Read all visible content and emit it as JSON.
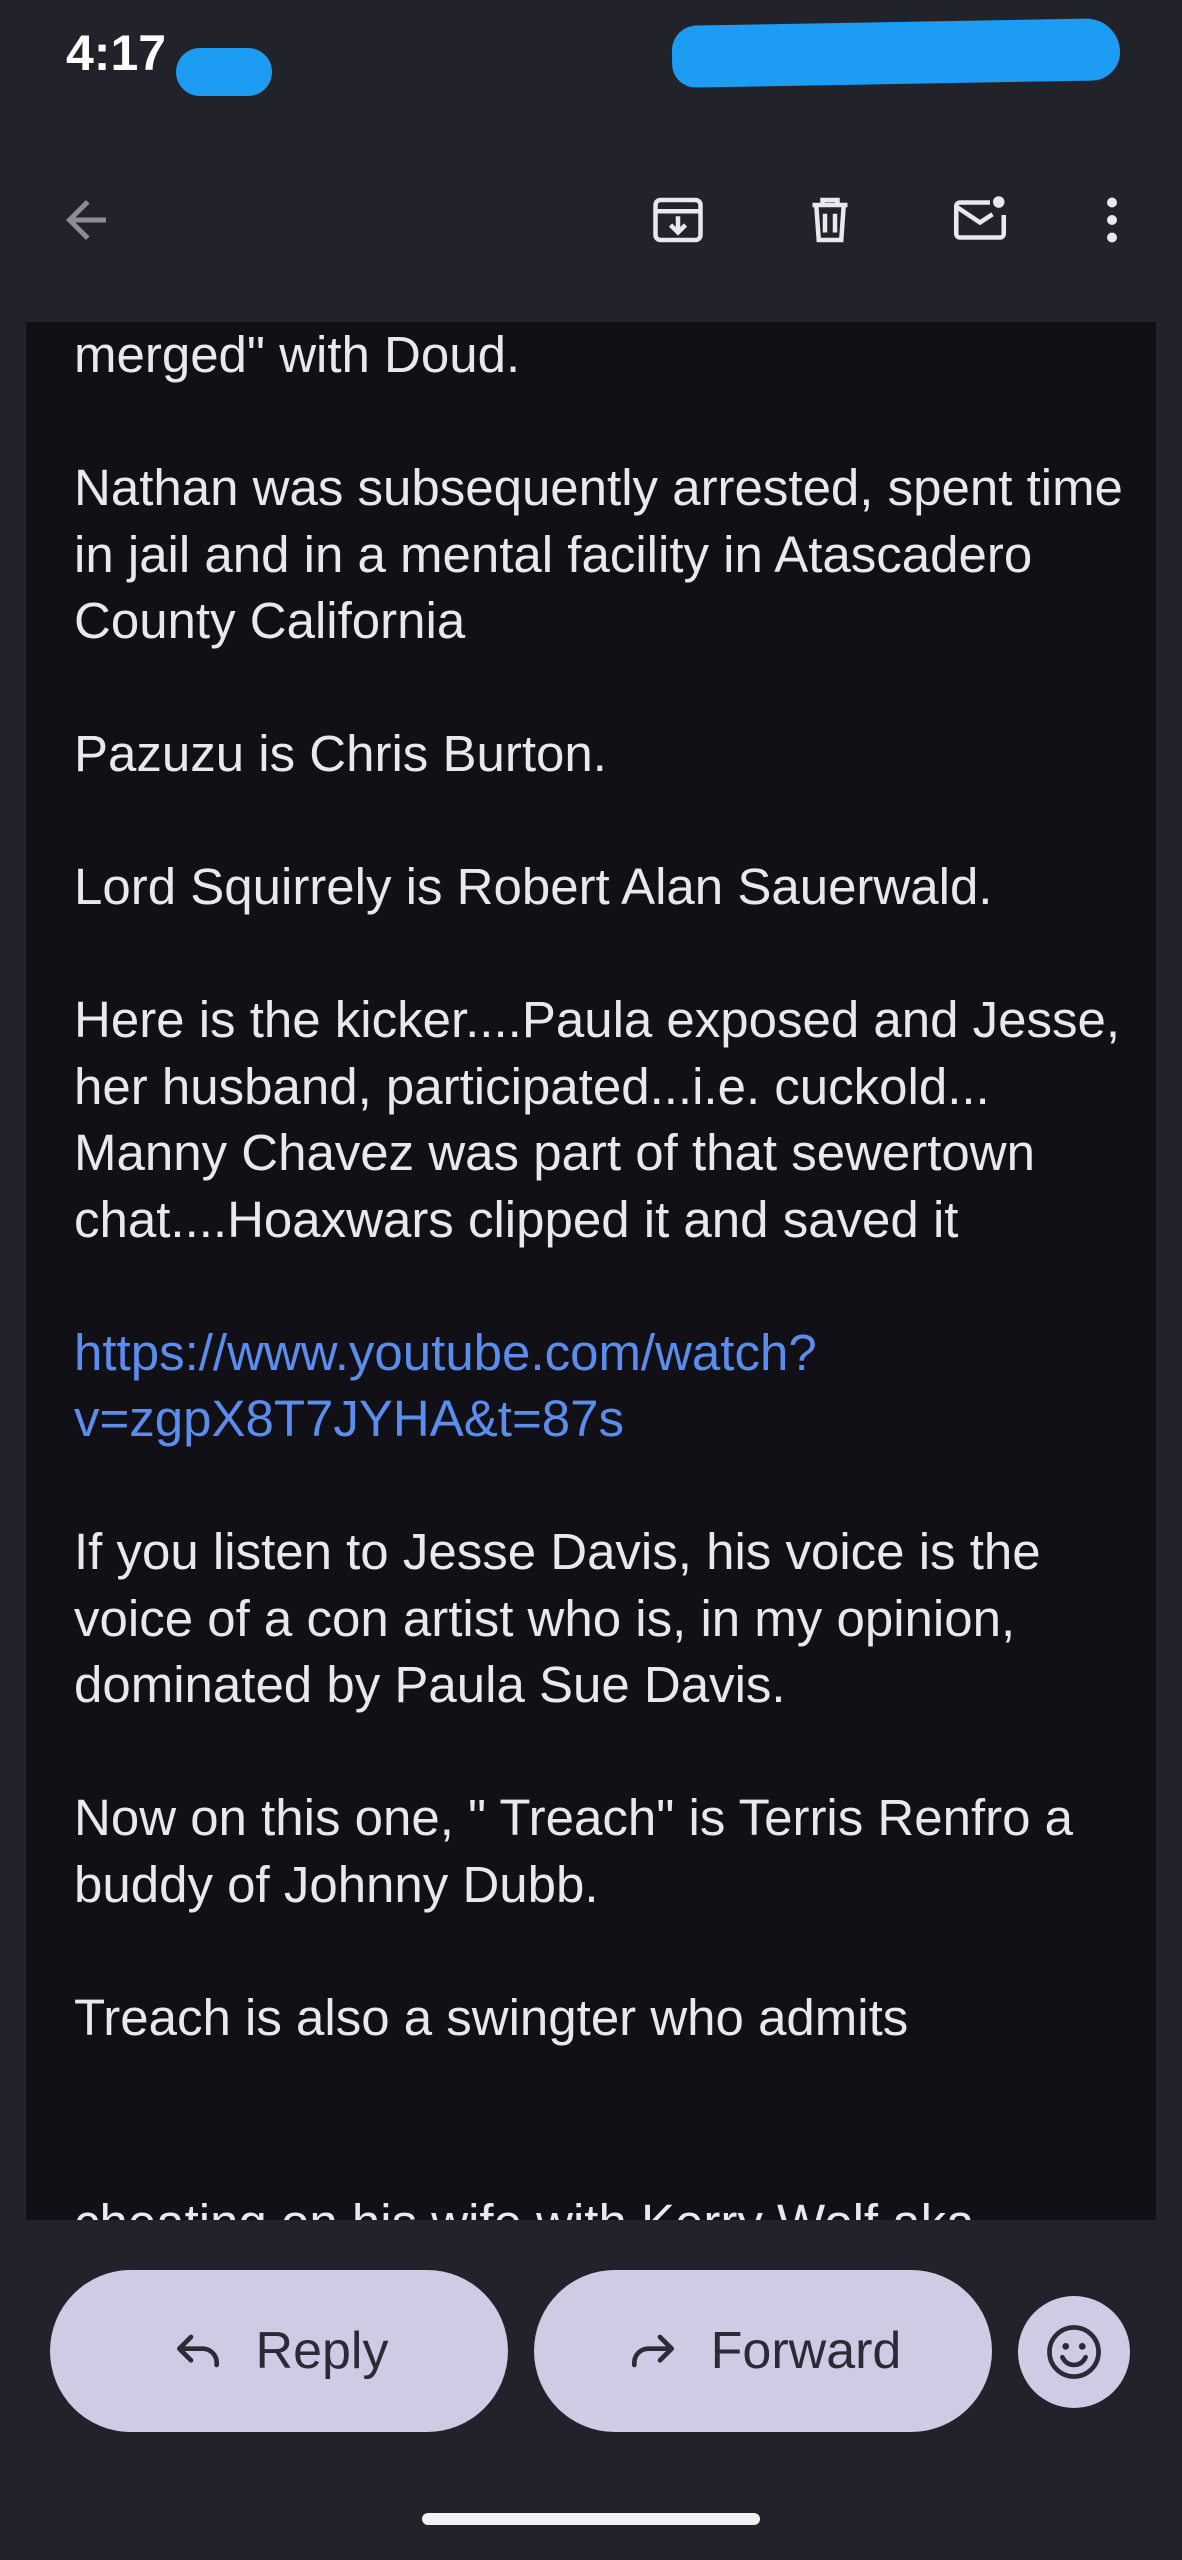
{
  "status_bar": {
    "time": "4:17"
  },
  "toolbar": {
    "back_icon": "arrow-left-icon",
    "archive_icon": "archive-icon",
    "delete_icon": "trash-icon",
    "mark_unread_icon": "mail-unread-icon",
    "more_icon": "more-vert-icon"
  },
  "email": {
    "line_0": "merged\" with Doud.",
    "para_1": "Nathan was subsequently arrested, spent time in jail and in a mental facility in Atascadero County California",
    "para_2": "Pazuzu is Chris Burton.",
    "para_3": "Lord Squirrely is Robert Alan Sauerwald.",
    "para_4a": "Here is the kicker....Paula exposed and Jesse, her husband, participated...i.e. cuckold...",
    "para_4b": "Manny Chavez was part of that sewertown chat....Hoaxwars clipped it and saved it",
    "link_1": "https://www.youtube.com/watch?",
    "link_2": "v=zgpX8T7JYHA&t=87s",
    "para_5": "If you listen to Jesse Davis, his voice is the voice of a con artist who is, in my opinion, dominated by Paula Sue Davis.",
    "para_6": "Now on this one, \" Treach\" is Terris Renfro a buddy of Johnny Dubb.",
    "para_7": "Treach is also a swingter who admits",
    "para_7_cut": "cheating on his wife with Kerry Wolf aka"
  },
  "actions": {
    "reply_label": "Reply",
    "forward_label": "Forward",
    "reply_icon": "reply-icon",
    "forward_icon": "forward-icon",
    "emoji_icon": "emoji-icon"
  },
  "colors": {
    "background": "#22232a",
    "body_background": "#111016",
    "link": "#5b8def",
    "pill": "#cfcbe4",
    "redaction": "#1c9cf2"
  }
}
